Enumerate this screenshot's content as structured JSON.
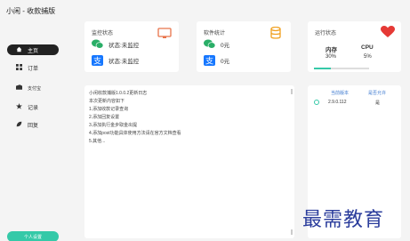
{
  "app": {
    "title": "小闲 - 收款捕版"
  },
  "sidebar": {
    "items": [
      {
        "label": "主页",
        "icon": "home-icon",
        "active": true
      },
      {
        "label": "订单",
        "icon": "grid-icon",
        "active": false
      },
      {
        "label": "支付宝",
        "icon": "wallet-icon",
        "active": false
      },
      {
        "label": "记录",
        "icon": "star-icon",
        "active": false
      },
      {
        "label": "回复",
        "icon": "leaf-icon",
        "active": false
      }
    ],
    "personal_button": "个人设置"
  },
  "monitor": {
    "title": "监控状态",
    "wechat_status": "状态:未监控",
    "alipay_status": "状态:未监控"
  },
  "stats": {
    "title": "软件统计",
    "wechat_amount": "0元",
    "alipay_amount": "0元"
  },
  "performance": {
    "title": "运行状态",
    "memory_label": "内存",
    "memory_value": "30%",
    "memory_fraction": 0.3,
    "cpu_label": "CPU",
    "cpu_value": "5%"
  },
  "log": {
    "lines": [
      "小闲收款捕版1.0.0.2更新日志",
      "本次更新内容如下",
      "1.添加收款记录查询",
      "2.添加回复设置",
      "3.添加执行金步取金出提",
      "4.添加post功能具体使用方法请在官方文档查看",
      "5.其他..."
    ]
  },
  "version": {
    "col_current": "当前版本",
    "col_update": "是否允许",
    "current_value": "2.9.0.112",
    "update_value": "是"
  },
  "watermark": "最需教育",
  "colors": {
    "accent": "#35c9a8",
    "wechat": "#2aae67",
    "alipay": "#1677ff",
    "heart": "#e53935",
    "db": "#f0a020"
  }
}
